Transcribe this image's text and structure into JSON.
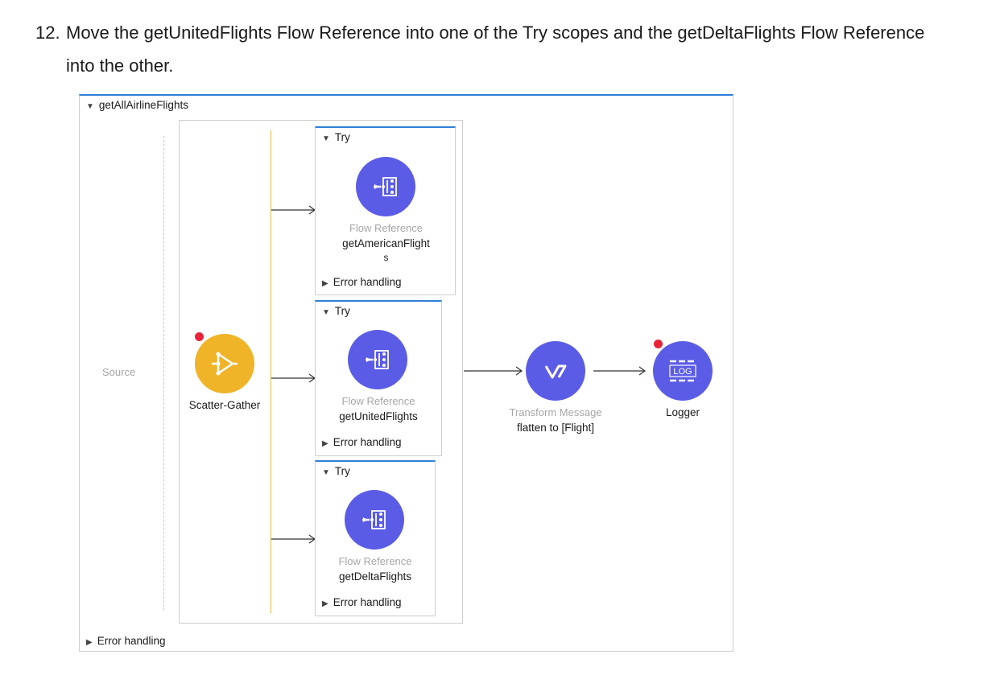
{
  "instruction": {
    "number": "12.",
    "text": "Move the getUnitedFlights Flow Reference into one of the Try scopes and the getDeltaFlights Flow Reference into the other."
  },
  "flow": {
    "name": "getAllAirlineFlights",
    "source_label": "Source",
    "error_handling": "Error handling"
  },
  "scatter_gather": {
    "label": "Scatter-Gather"
  },
  "try_scopes": [
    {
      "title": "Try",
      "component_type": "Flow Reference",
      "line1": "getAmericanFlight",
      "line2": "s",
      "error_handling": "Error handling"
    },
    {
      "title": "Try",
      "component_type": "Flow Reference",
      "line1": "getUnitedFlights",
      "line2": "",
      "error_handling": "Error handling"
    },
    {
      "title": "Try",
      "component_type": "Flow Reference",
      "line1": "getDeltaFlights",
      "line2": "",
      "error_handling": "Error handling"
    }
  ],
  "transform": {
    "type": "Transform Message",
    "label": "flatten to [Flight]"
  },
  "logger": {
    "label": "Logger",
    "icon_text": "LOG"
  },
  "colors": {
    "accent_blue": "#2f7fd8",
    "flow_ref": "#5b5ce6",
    "scatter_gather": "#f0b429",
    "breakpoint": "#e8243a",
    "scope_line": "#e2b93b"
  }
}
